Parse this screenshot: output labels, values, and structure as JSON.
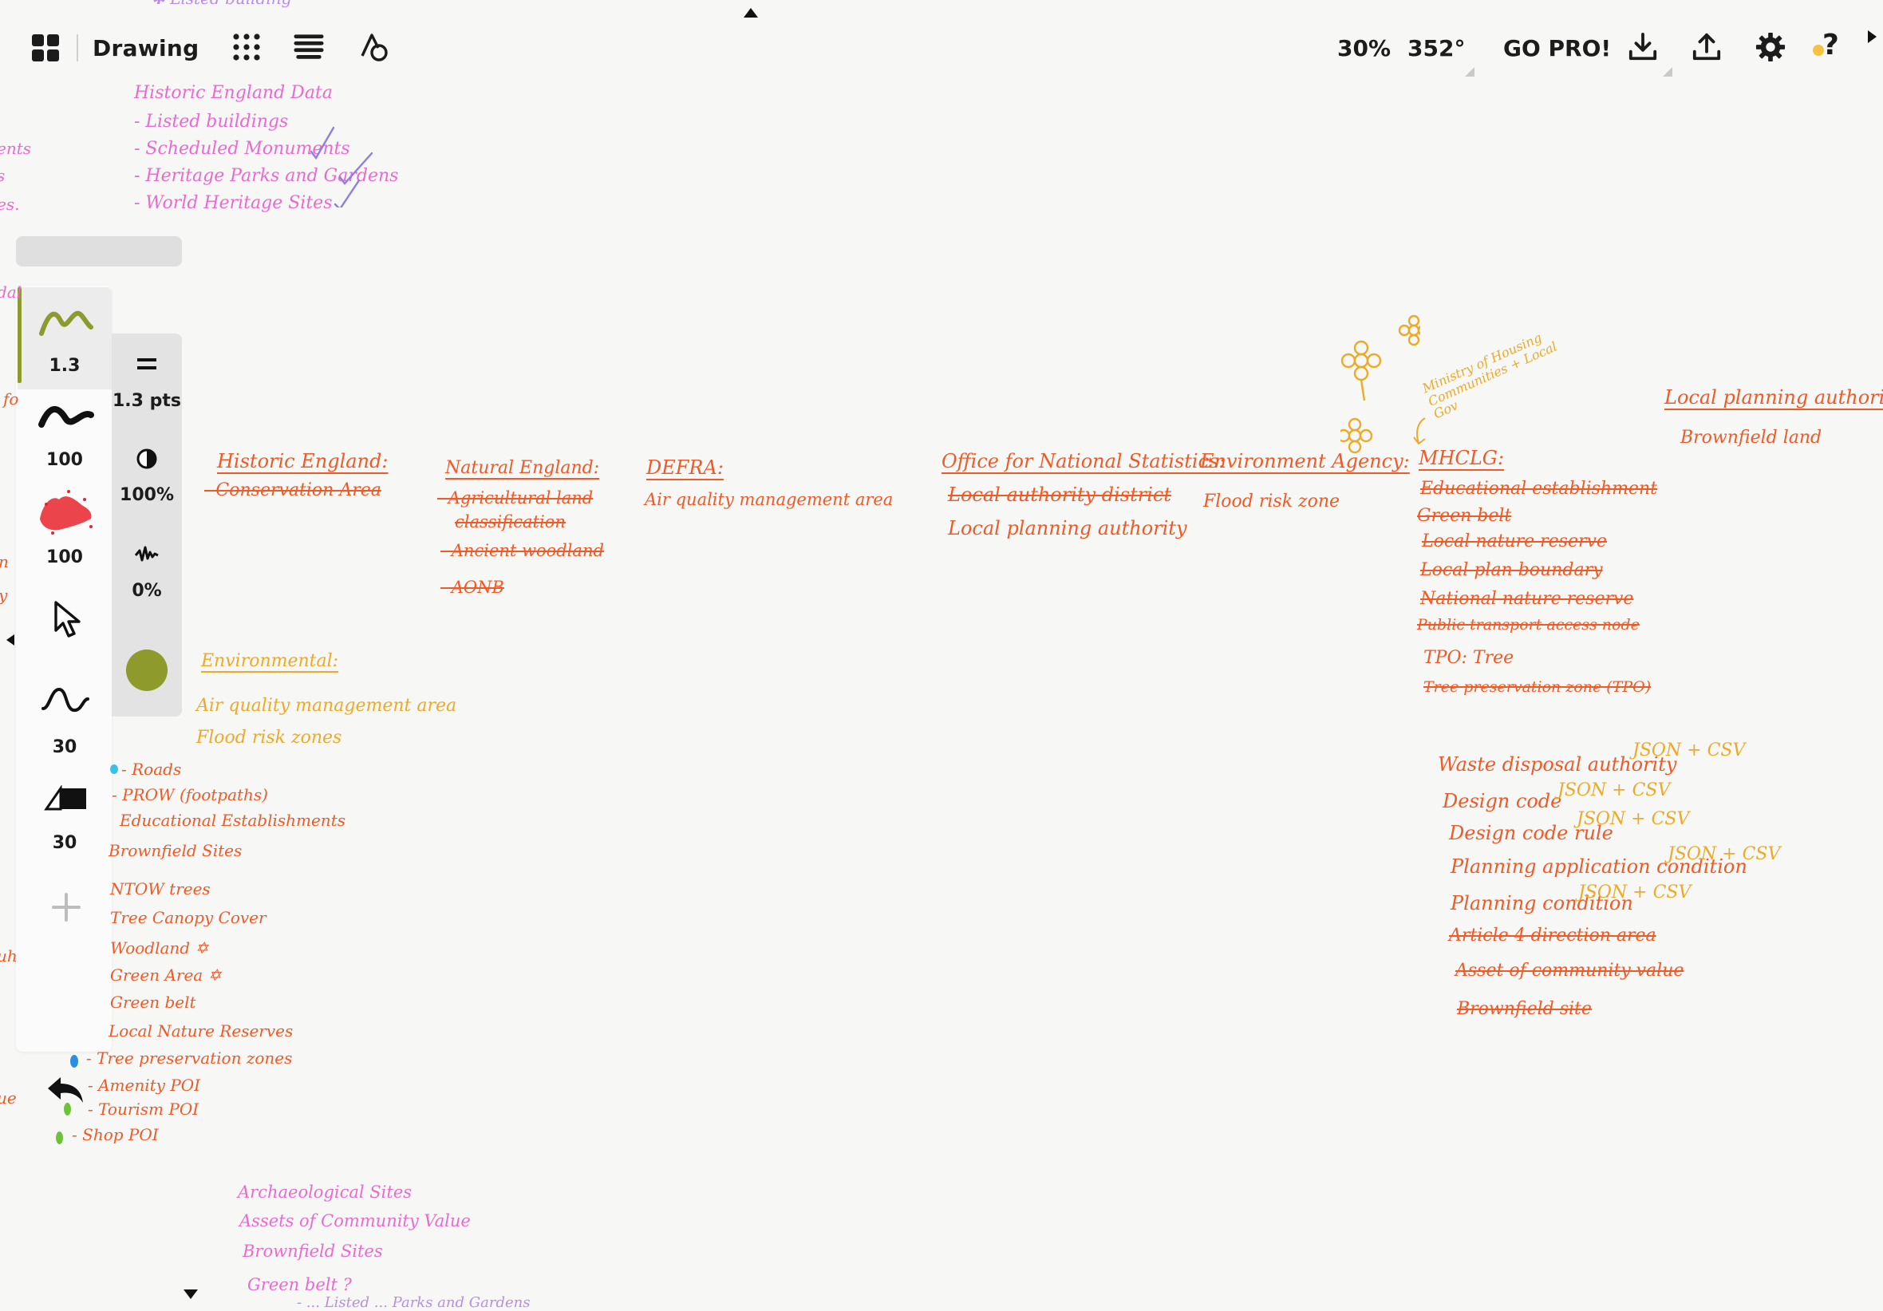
{
  "toolbar": {
    "app_name": "Drawing",
    "zoom": "30%",
    "rotation": "352°",
    "go_pro": "GO PRO!"
  },
  "tools": {
    "pen_size": "1.3",
    "brush_opacity": "100",
    "airbrush_opacity": "100",
    "smoothing": "30",
    "eraser_size": "30"
  },
  "properties": {
    "stroke_size": "1.3 pts",
    "opacity": "100%",
    "jitter": "0%",
    "color": "#8f9a2d"
  },
  "colors": {
    "pink": "#e86bd0",
    "orange": "#ee5a28",
    "yellow": "#ebaa2a",
    "lavender": "#b78ee6",
    "accent_pen": "#8c9a2e"
  },
  "notes": {
    "top_fragment": "✱ Listed building",
    "he_data": {
      "title": "Historic England Data",
      "items": [
        "- Listed buildings",
        "- Scheduled Monuments",
        "- Heritage Parks and Gardens",
        "- World Heritage Sites"
      ]
    },
    "left_edge": [
      "ents",
      "s",
      "es.",
      "dal",
      "fo",
      "n",
      "y",
      "uh",
      "ue"
    ],
    "historic_england": {
      "title": "Historic England:",
      "items": [
        "- Conservation Area"
      ]
    },
    "natural_england": {
      "title": "Natural England:",
      "items": [
        "- Agricultural land",
        "classification",
        "- Ancient woodland",
        "- AONB"
      ]
    },
    "defra": {
      "title": "DEFRA:",
      "items": [
        "Air quality management area"
      ]
    },
    "ons": {
      "title": "Office for National Statistics:",
      "items": [
        "Local authority district",
        "Local planning authority"
      ]
    },
    "env_agency": {
      "title": "Environment Agency:",
      "items": [
        "Flood risk zone"
      ]
    },
    "mhclg_note": "Ministry of Housing Communities + Local Gov",
    "mhclg": {
      "title": "MHCLG:",
      "items": [
        "Educational establishment",
        "Green belt",
        "Local nature reserve",
        "Local plan boundary",
        "National nature reserve",
        "Public transport access node",
        "TPO: Tree",
        "Tree preservation zone (TPO)"
      ]
    },
    "lpa": {
      "title": "Local planning authorities:",
      "items": [
        "Brownfield land"
      ]
    },
    "environmental": {
      "title": "Environmental:",
      "items": [
        "Air quality management area",
        "Flood risk zones"
      ]
    },
    "left_list": [
      "- Roads",
      "- PROW (footpaths)",
      "Educational Establishments",
      "Brownfield Sites",
      "NTOW trees",
      "Tree Canopy Cover",
      "Woodland ✡",
      "Green Area ✡",
      "Green belt",
      "Local Nature Reserves",
      "- Tree preservation zones",
      "- Amenity POI",
      "- Tourism POI",
      "- Shop POI"
    ],
    "waste": {
      "items": [
        "Waste disposal authority",
        "Design code",
        "Design code rule",
        "Planning application condition",
        "Planning condition",
        "Article 4 direction area",
        "Asset of community value",
        "Brownfield site"
      ],
      "formats": [
        "JSON + CSV",
        "JSON + CSV",
        "JSON + CSV",
        "JSON + CSV",
        "JSON + CSV"
      ]
    },
    "bottom": [
      "Archaeological Sites",
      "Assets of Community Value",
      "Brownfield Sites",
      "Green belt ?"
    ],
    "bottom_cut": "- ... Listed ... Parks and Gardens"
  }
}
